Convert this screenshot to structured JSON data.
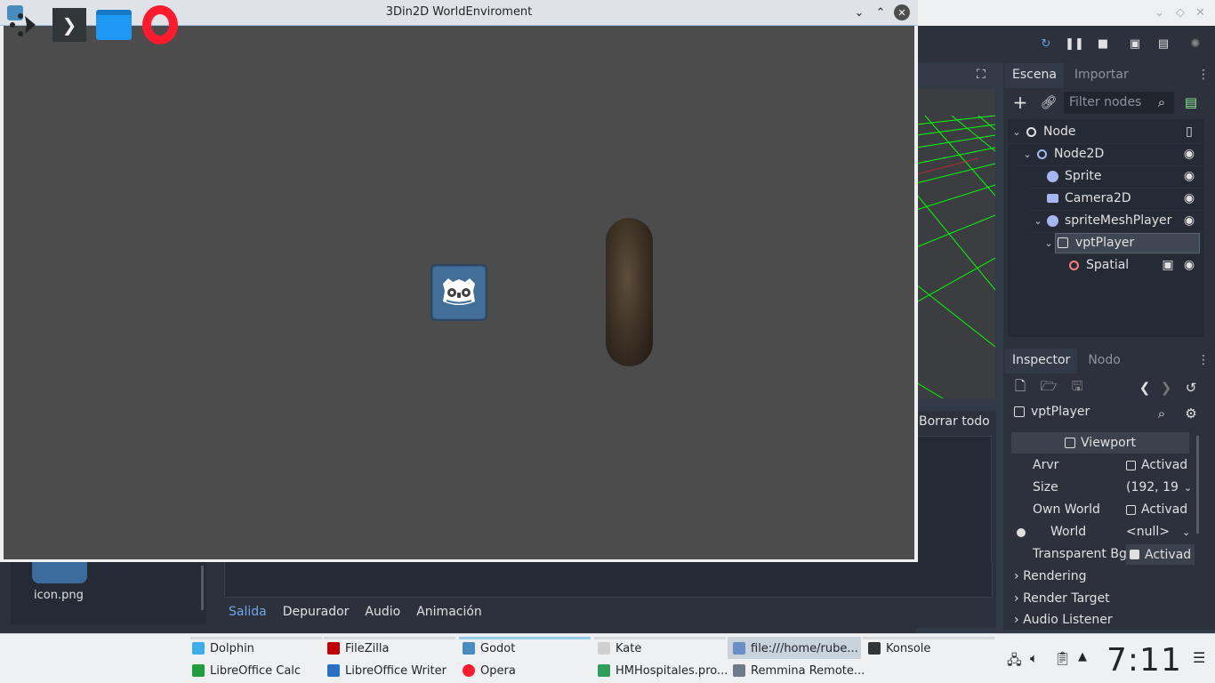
{
  "window": {
    "title": "3Din2D WorldEnviroment",
    "icon": "godot-icon",
    "controls": [
      "minimize-icon",
      "maximize-icon",
      "close-icon"
    ]
  },
  "editor": {
    "clear_output": "Borrar todo",
    "bottom_tabs": [
      {
        "label": "Salida",
        "active": true
      },
      {
        "label": "Depurador",
        "active": false
      },
      {
        "label": "Audio",
        "active": false
      },
      {
        "label": "Animación",
        "active": false
      }
    ],
    "filesystem": {
      "file_name": "icon.png"
    }
  },
  "scene_dock": {
    "tabs": [
      {
        "label": "Escena",
        "active": true
      },
      {
        "label": "Importar",
        "active": false
      }
    ],
    "filter_placeholder": "Filter nodes",
    "tree": [
      {
        "name": "Node",
        "icon": "node-icon"
      },
      {
        "name": "Node2D",
        "icon": "node2d-icon"
      },
      {
        "name": "Sprite",
        "icon": "sprite-icon"
      },
      {
        "name": "Camera2D",
        "icon": "camera2d-icon"
      },
      {
        "name": "spriteMeshPlayer",
        "icon": "sprite-icon"
      },
      {
        "name": "vptPlayer",
        "icon": "viewport-icon",
        "selected": true
      },
      {
        "name": "Spatial",
        "icon": "spatial-icon"
      }
    ]
  },
  "inspector": {
    "tabs": [
      {
        "label": "Inspector",
        "active": true
      },
      {
        "label": "Nodo",
        "active": false
      }
    ],
    "node_name": "vptPlayer",
    "section": "Viewport",
    "properties": [
      {
        "name": "Arvr",
        "value": "Activad",
        "checked": false
      },
      {
        "name": "Size",
        "value": "(192, 19"
      },
      {
        "name": "Own World",
        "value": "Activad",
        "checked": false
      },
      {
        "name": "World",
        "value": "<null>"
      },
      {
        "name": "Transparent Bg",
        "value": "Activad",
        "checked": true
      }
    ],
    "groups": [
      "Rendering",
      "Render Target",
      "Audio Listener"
    ]
  },
  "taskbar": {
    "tasks_row1": [
      {
        "label": "Dolphin",
        "color": "#3daee9"
      },
      {
        "label": "FileZilla",
        "color": "#bf0000"
      },
      {
        "label": "Godot",
        "color": "#478cbf"
      },
      {
        "label": "Kate",
        "color": "#b0b0b0"
      },
      {
        "label": "file:///home/rube...",
        "color": "#6a8fc8"
      },
      {
        "label": "Konsole",
        "color": "#31363b"
      }
    ],
    "tasks_row2": [
      {
        "label": "LibreOffice Calc",
        "color": "#1e9e3e"
      },
      {
        "label": "LibreOffice Writer",
        "color": "#2a70c2"
      },
      {
        "label": "Opera",
        "color": "#ff1b2d"
      },
      {
        "label": "HMHospitales.pro...",
        "color": "#2e9e5a"
      },
      {
        "label": "Remmina Remote...",
        "color": "#6c7a89"
      }
    ],
    "clock": "7:11"
  },
  "colors": {
    "editor_bg": "#333a47",
    "panel_bg": "#2c313c",
    "game_bg": "#4c4c4c",
    "accent": "#6ea8e6",
    "grid_green": "#00ff00"
  }
}
